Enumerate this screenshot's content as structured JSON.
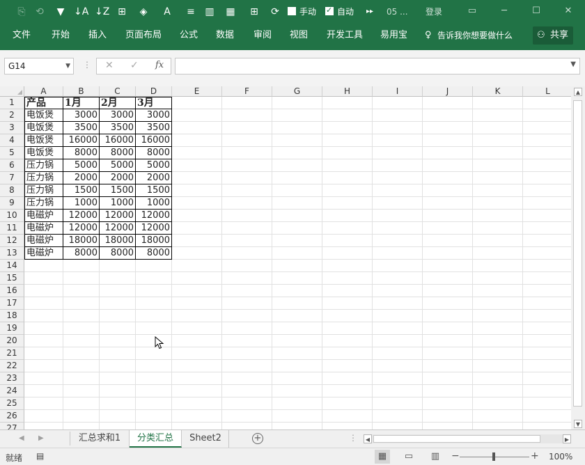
{
  "qat": {
    "manual_label": "手动",
    "auto_label": "自动",
    "manual_checked": false,
    "auto_checked": true,
    "title": "05 ...",
    "login": "登录"
  },
  "ribbon": {
    "tabs": [
      "文件",
      "开始",
      "插入",
      "页面布局",
      "公式",
      "数据",
      "审阅",
      "视图",
      "开发工具",
      "易用宝"
    ],
    "tell_me": "告诉我你想要做什么",
    "share": "共享"
  },
  "formula_bar": {
    "name_box": "G14",
    "cancel": "✕",
    "enter": "✓",
    "fx": "fx",
    "formula": ""
  },
  "sheet": {
    "columns": [
      "A",
      "B",
      "C",
      "D",
      "E",
      "F",
      "G",
      "H",
      "I",
      "J",
      "K",
      "L"
    ],
    "rows": [
      "1",
      "2",
      "3",
      "4",
      "5",
      "6",
      "7",
      "8",
      "9",
      "10",
      "11",
      "12",
      "13",
      "14",
      "15",
      "16",
      "17",
      "18",
      "19",
      "20",
      "21",
      "22",
      "23",
      "24",
      "25",
      "26",
      "27"
    ],
    "header": [
      "产品",
      "1月",
      "2月",
      "3月"
    ],
    "data": [
      [
        "电饭煲",
        "3000",
        "3000",
        "3000"
      ],
      [
        "电饭煲",
        "3500",
        "3500",
        "3500"
      ],
      [
        "电饭煲",
        "16000",
        "16000",
        "16000"
      ],
      [
        "电饭煲",
        "8000",
        "8000",
        "8000"
      ],
      [
        "压力锅",
        "5000",
        "5000",
        "5000"
      ],
      [
        "压力锅",
        "2000",
        "2000",
        "2000"
      ],
      [
        "压力锅",
        "1500",
        "1500",
        "1500"
      ],
      [
        "压力锅",
        "1000",
        "1000",
        "1000"
      ],
      [
        "电磁炉",
        "12000",
        "12000",
        "12000"
      ],
      [
        "电磁炉",
        "12000",
        "12000",
        "12000"
      ],
      [
        "电磁炉",
        "18000",
        "18000",
        "18000"
      ],
      [
        "电磁炉",
        "8000",
        "8000",
        "8000"
      ]
    ]
  },
  "sheet_tabs": {
    "tabs": [
      "汇总求和1",
      "分类汇总",
      "Sheet2"
    ],
    "active": "分类汇总"
  },
  "status": {
    "ready": "就绪",
    "zoom": "100%"
  },
  "colors": {
    "accent": "#217346"
  }
}
